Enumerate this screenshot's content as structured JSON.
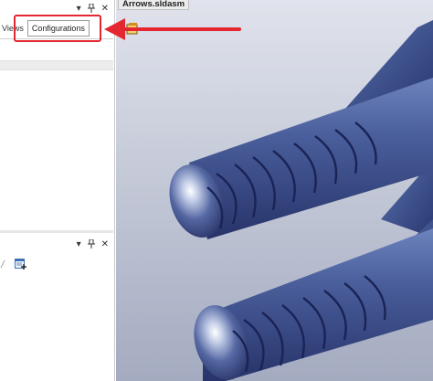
{
  "left_pane": {
    "tabs": [
      {
        "label": "Views"
      },
      {
        "label": "Configurations",
        "selected": true
      }
    ],
    "icons": [
      "dropdown-arrow-icon",
      "pin-icon",
      "close-icon",
      "add-configuration-icon"
    ]
  },
  "document": {
    "tab_label": "Arrows.sldasm"
  },
  "colors": {
    "annotation_red": "#e3262f",
    "model_blue": "#3a4f8c",
    "viewport_top": "#d9dde8",
    "viewport_bottom": "#a8aec2"
  }
}
